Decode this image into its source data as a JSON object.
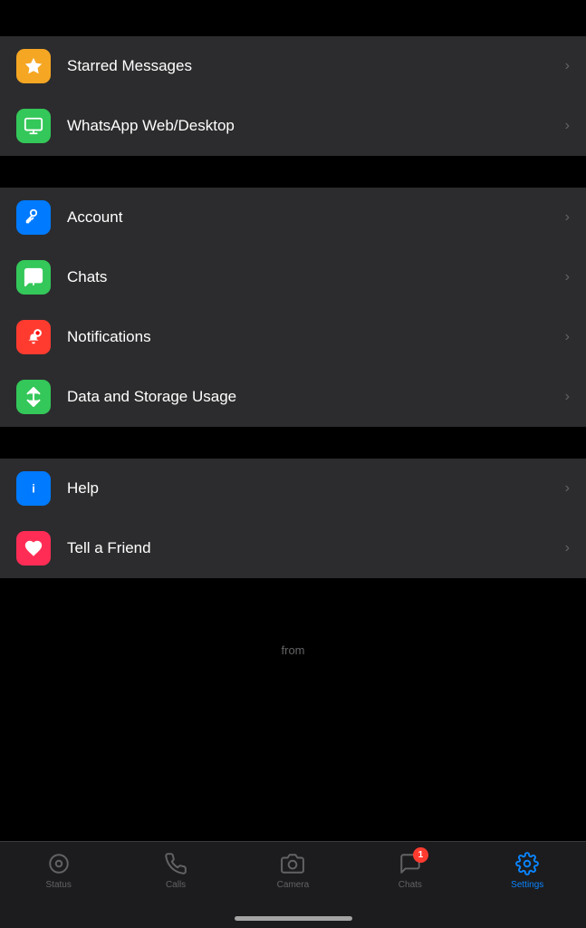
{
  "topSection": {
    "items": [
      {
        "id": "starred-messages",
        "label": "Starred Messages",
        "iconColor": "#f5a623",
        "iconType": "star"
      },
      {
        "id": "whatsapp-web",
        "label": "WhatsApp Web/Desktop",
        "iconColor": "#34c759",
        "iconType": "desktop"
      }
    ]
  },
  "middleSection": {
    "items": [
      {
        "id": "account",
        "label": "Account",
        "iconColor": "#007aff",
        "iconType": "key"
      },
      {
        "id": "chats",
        "label": "Chats",
        "iconColor": "#34c759",
        "iconType": "whatsapp"
      },
      {
        "id": "notifications",
        "label": "Notifications",
        "iconColor": "#ff3b30",
        "iconType": "bell"
      },
      {
        "id": "data-storage",
        "label": "Data and Storage Usage",
        "iconColor": "#34c759",
        "iconType": "arrows"
      }
    ]
  },
  "bottomSection": {
    "items": [
      {
        "id": "help",
        "label": "Help",
        "iconColor": "#007aff",
        "iconType": "info"
      },
      {
        "id": "tell-friend",
        "label": "Tell a Friend",
        "iconColor": "#ff2d55",
        "iconType": "heart"
      }
    ]
  },
  "fromText": "from",
  "nav": {
    "items": [
      {
        "id": "status",
        "label": "Status",
        "iconType": "status",
        "active": false,
        "badge": 0
      },
      {
        "id": "calls",
        "label": "Calls",
        "iconType": "calls",
        "active": false,
        "badge": 0
      },
      {
        "id": "camera",
        "label": "Camera",
        "iconType": "camera",
        "active": false,
        "badge": 0
      },
      {
        "id": "chats",
        "label": "Chats",
        "iconType": "chats",
        "active": false,
        "badge": 1
      },
      {
        "id": "settings",
        "label": "Settings",
        "iconType": "settings",
        "active": true,
        "badge": 0
      }
    ]
  }
}
